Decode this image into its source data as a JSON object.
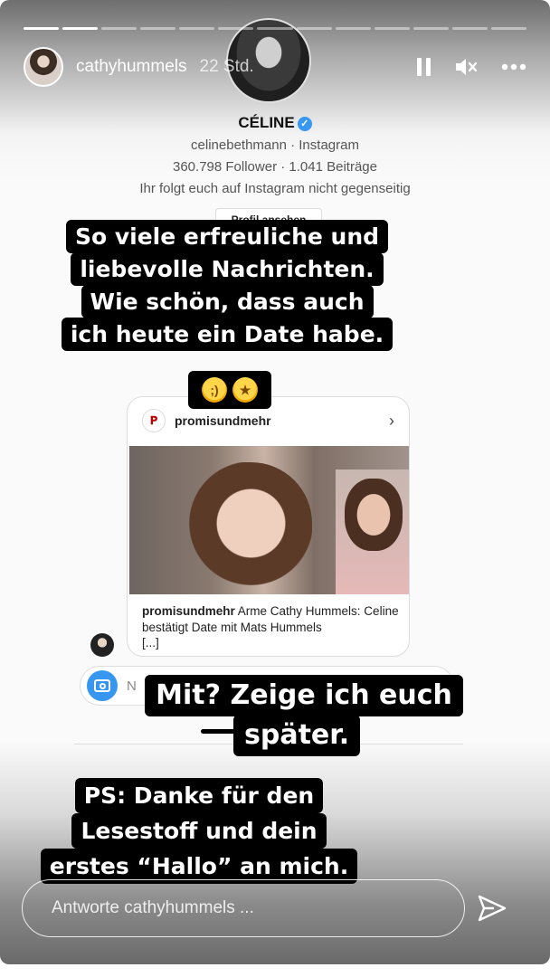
{
  "story": {
    "progress_segments_total": 13,
    "progress_segments_done": 2,
    "username": "cathyhummels",
    "time_ago": "22 Std.",
    "controls": [
      "pause-icon",
      "mute-icon",
      "more-icon"
    ]
  },
  "profile": {
    "name": "CÉLINE",
    "verified_mark": "✓",
    "handle_line": "celinebethmann · Instagram",
    "stats_line": "360.798 Follower · 1.041 Beiträge",
    "follow_line": "Ihr folgt euch auf Instagram nicht gegenseitig",
    "view_profile_button": "Profil ansehen"
  },
  "caption1": {
    "lines": [
      "So viele erfreuliche und",
      "liebevolle Nachrichten.",
      "Wie schön, dass auch",
      "ich heute ein Date habe."
    ],
    "emojis": [
      "winking-face-emoji",
      "star-struck-emoji"
    ]
  },
  "post": {
    "account": "promisundmehr",
    "caption_user": "promisundmehr",
    "caption_text": "Arme Cathy Hummels: Celine bestätigt Date mit Mats Hummels",
    "caption_more": "[...]",
    "chevron": "›"
  },
  "dm": {
    "input_letter": "N"
  },
  "caption2": {
    "lines": [
      "Mit? Zeige ich euch",
      "später."
    ]
  },
  "caption3": {
    "lines": [
      "PS: Danke für den",
      "Lesestoff und dein",
      "erstes “Hallo” an mich."
    ]
  },
  "reply": {
    "placeholder": "Antworte cathyhummels ..."
  },
  "colors": {
    "verified_blue": "#3897f0",
    "camera_blue": "#3797f0",
    "caption_bg": "#000000"
  }
}
